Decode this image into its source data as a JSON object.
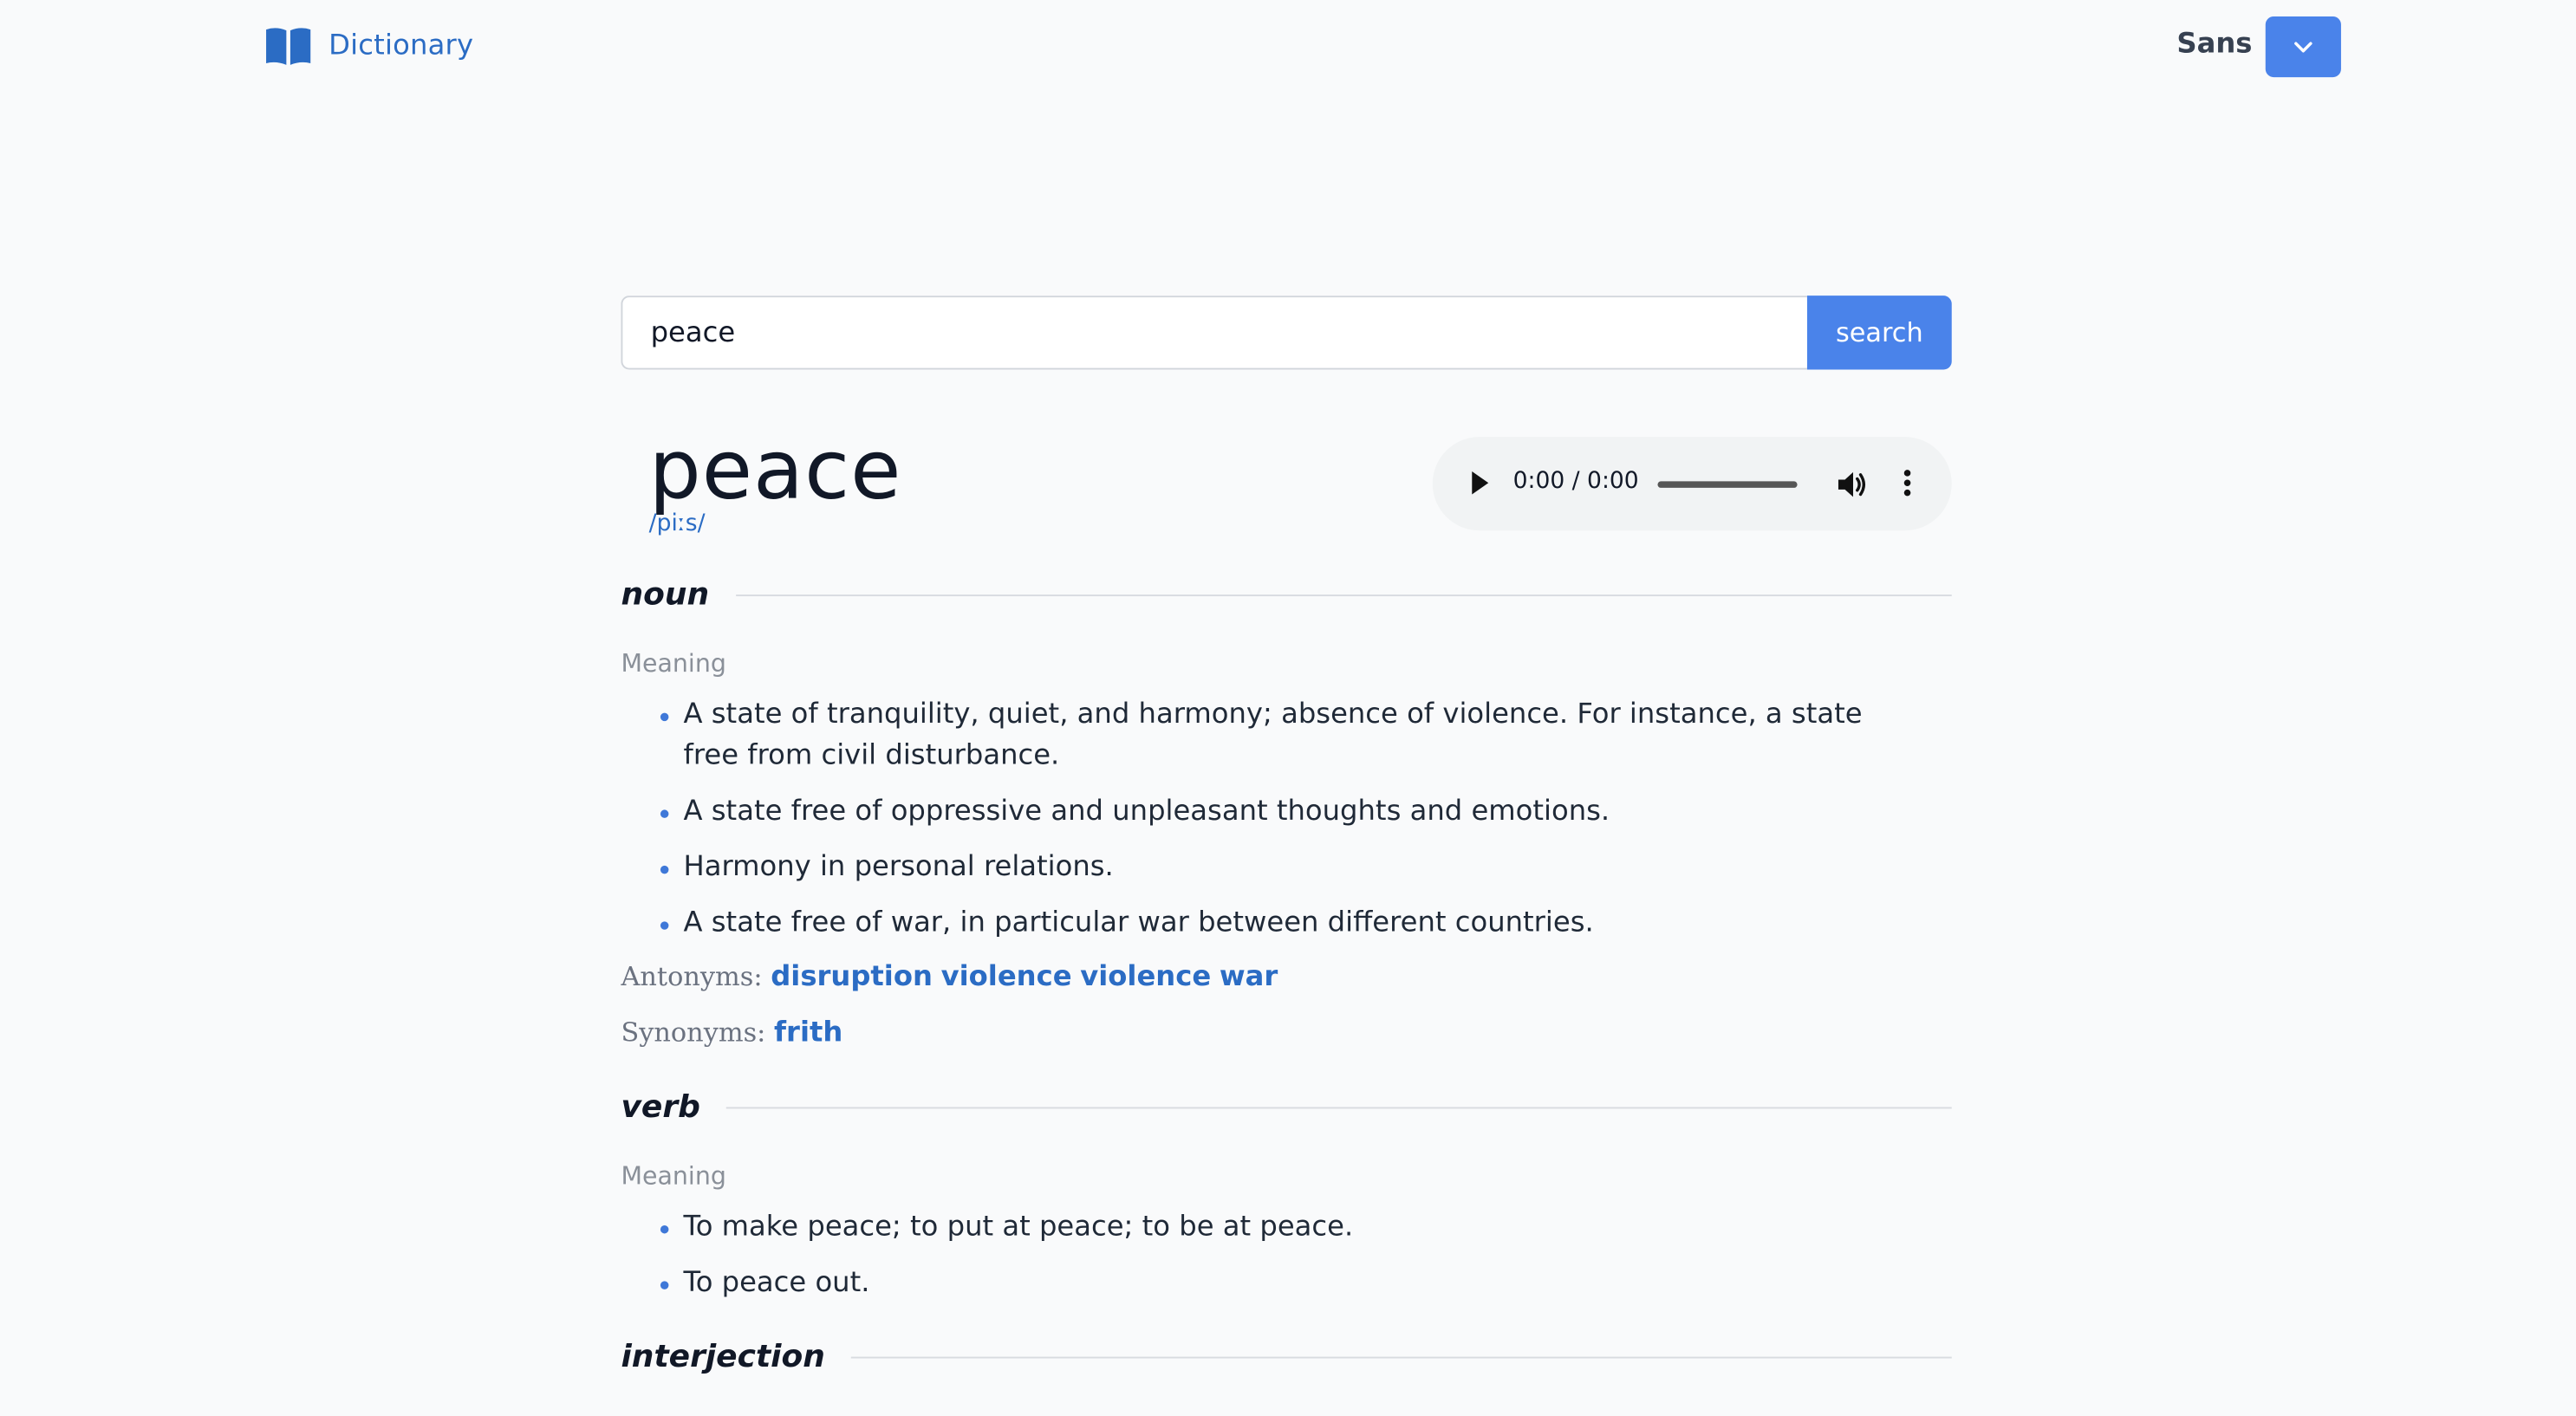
{
  "header": {
    "brand_label": "Dictionary",
    "font_label": "Sans"
  },
  "search": {
    "value": "peace",
    "button_label": "search"
  },
  "entry": {
    "word": "peace",
    "phonetic": "/piːs/"
  },
  "audio": {
    "time": "0:00 / 0:00",
    "progress": 0
  },
  "sections": [
    {
      "part_of_speech": "noun",
      "meaning_label": "Meaning",
      "definitions": [
        "A state of tranquility, quiet, and harmony; absence of violence. For instance, a state free from civil disturbance.",
        "A state free of oppressive and unpleasant thoughts and emotions.",
        "Harmony in personal relations.",
        "A state free of war, in particular war between different countries."
      ],
      "antonyms_label": "Antonyms:",
      "antonyms": [
        "disruption",
        "violence",
        "violence",
        "war"
      ],
      "synonyms_label": "Synonyms:",
      "synonyms": [
        "frith"
      ]
    },
    {
      "part_of_speech": "verb",
      "meaning_label": "Meaning",
      "definitions": [
        "To make peace; to put at peace; to be at peace.",
        "To peace out."
      ]
    },
    {
      "part_of_speech": "interjection"
    }
  ],
  "colors": {
    "accent": "#4a83ea",
    "link": "#2b6cc4",
    "background": "#f9fafb"
  },
  "icons": {
    "brand": "open-book-icon",
    "dropdown": "chevron-down-icon",
    "play": "play-icon",
    "volume": "volume-icon",
    "more": "more-vertical-icon"
  }
}
